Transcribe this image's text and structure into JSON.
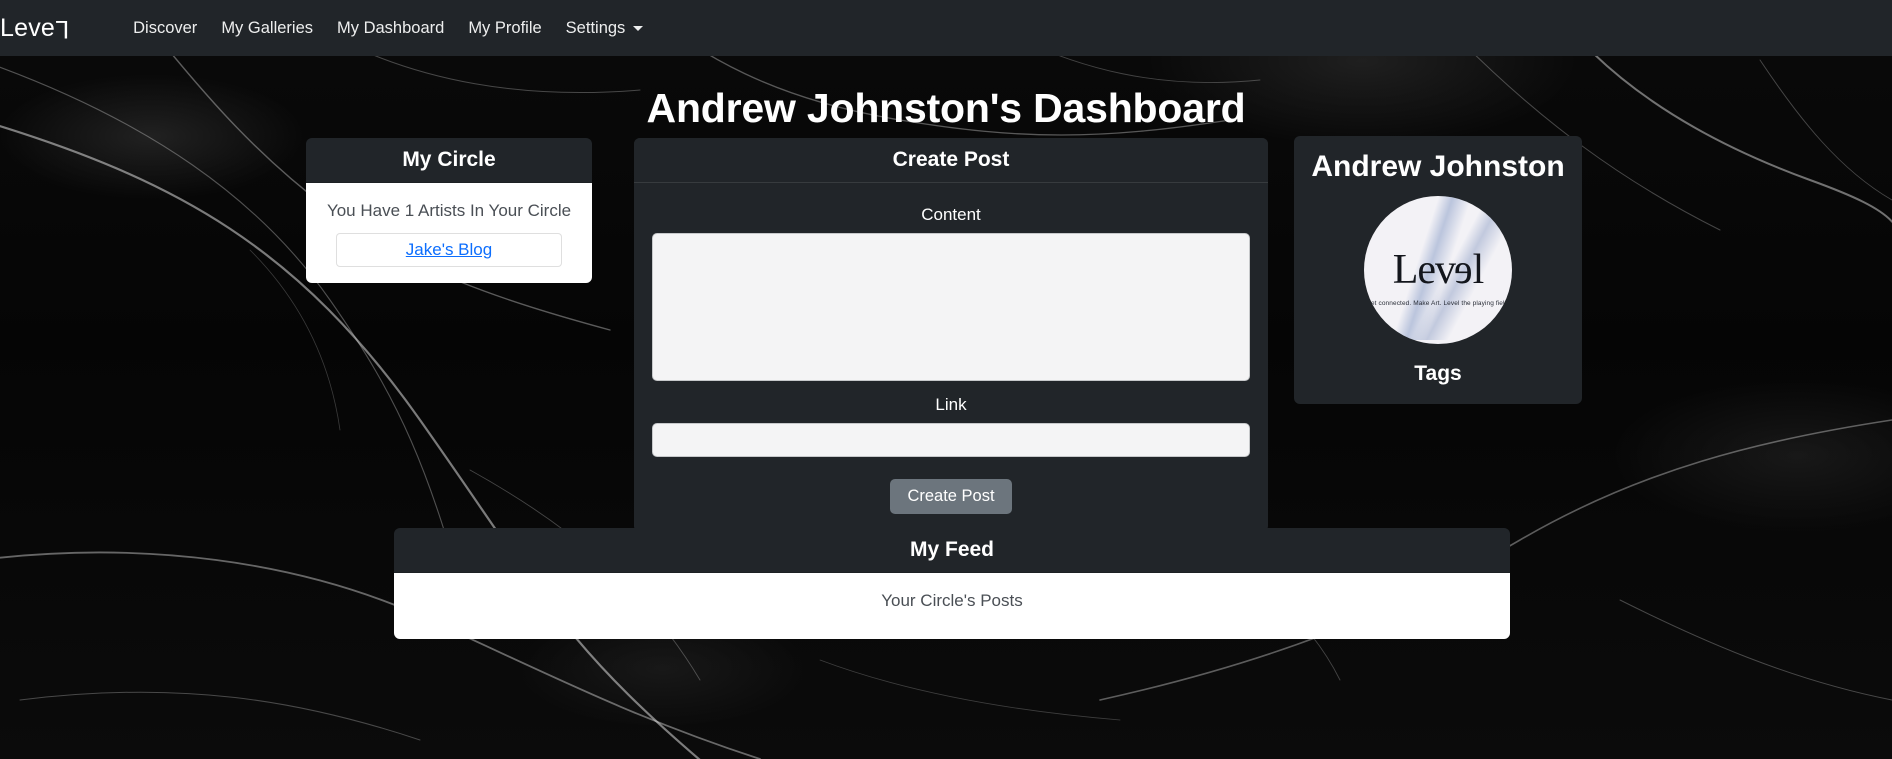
{
  "navbar": {
    "brand": "Level",
    "brand_prefix": "Leve",
    "brand_suffix": "L",
    "links": [
      {
        "label": "Discover"
      },
      {
        "label": "My Galleries"
      },
      {
        "label": "My Dashboard"
      },
      {
        "label": "My Profile"
      },
      {
        "label": "Settings",
        "has_caret": true
      }
    ]
  },
  "page": {
    "title": "Andrew Johnston's Dashboard"
  },
  "my_circle": {
    "header": "My Circle",
    "count_text": "You Have 1 Artists In Your Circle",
    "artists": [
      {
        "label": "Jake's Blog"
      }
    ]
  },
  "create_post": {
    "header": "Create Post",
    "content_label": "Content",
    "content_value": "",
    "content_placeholder": "",
    "link_label": "Link",
    "link_value": "",
    "link_placeholder": "",
    "submit_label": "Create Post"
  },
  "profile": {
    "name": "Andrew Johnston",
    "avatar_logo_prefix": "Lev",
    "avatar_logo_flip": "e",
    "avatar_logo_suffix": "l",
    "avatar_tagline": "Get connected. Make Art. Level the playing field.",
    "tags_label": "Tags"
  },
  "feed": {
    "header": "My Feed",
    "body_text": "Your Circle's Posts"
  },
  "colors": {
    "dark_panel": "#212529",
    "link_blue": "#0d6efd",
    "btn_secondary": "#6c757d",
    "input_bg": "#f4f4f5"
  }
}
